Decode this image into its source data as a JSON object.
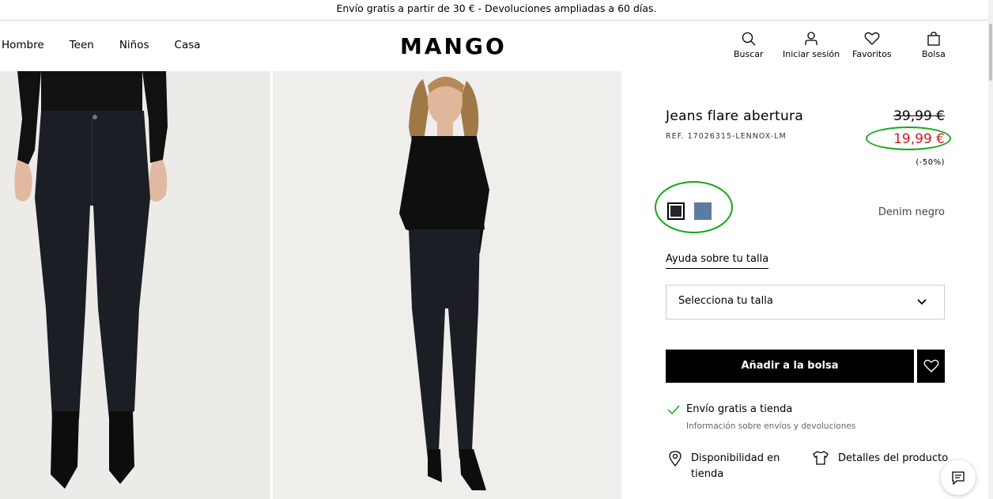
{
  "promo": "Envío gratis a partir de 30 € - Devoluciones ampliadas a 60 días.",
  "nav": [
    "Hombre",
    "Teen",
    "Niños",
    "Casa"
  ],
  "logo": "MANGO",
  "header_actions": {
    "search": "Buscar",
    "login": "Iniciar sesión",
    "favorites": "Favoritos",
    "bag": "Bolsa"
  },
  "product": {
    "title": "Jeans flare abertura",
    "ref": "REF. 17026315-LENNOX-LM",
    "old_price": "39,99 €",
    "new_price": "19,99 €",
    "discount": "(-50%)",
    "colors": [
      {
        "name": "black-swatch",
        "hex": "#24262d"
      },
      {
        "name": "blue-swatch",
        "hex": "#5d7aa0"
      }
    ],
    "color_name": "Denim negro",
    "size_help": "Ayuda sobre tu talla",
    "size_select": "Selecciona tu talla",
    "add_to_bag": "Añadir a la bolsa",
    "shipping": "Envío gratis a tienda",
    "shipping_info": "Información sobre envíos y devoluciones",
    "availability": "Disponibilidad en tienda",
    "details": "Detalles del producto"
  },
  "colors": {
    "price_red": "#d21a1a",
    "annotation_green": "#14a814"
  }
}
